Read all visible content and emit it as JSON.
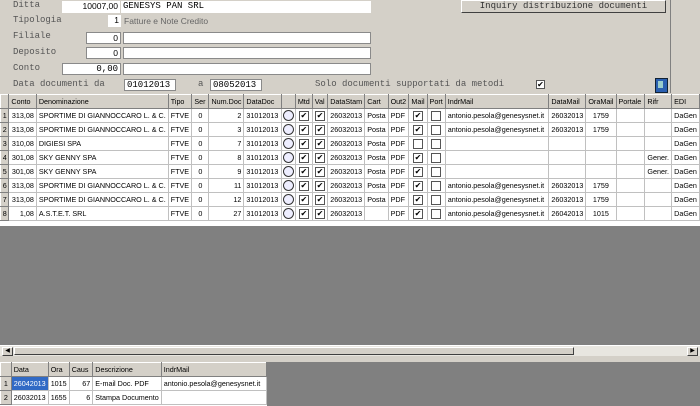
{
  "form": {
    "ditta_label": "Ditta",
    "ditta_code": "10007,00",
    "ditta_name": "GENESYS PAN SRL",
    "tipologia_label": "Tipologia",
    "tipologia_value": "1",
    "tipologia_desc": "Fatture e Note Credito",
    "filiale_label": "Filiale",
    "filiale_value": "0",
    "deposito_label": "Deposito",
    "deposito_value": "0",
    "conto_label": "Conto",
    "conto_value": "0,00",
    "data_label": "Data documenti da",
    "data_from": "01012013",
    "data_to_label": "a",
    "data_to": "08052013",
    "solo_label": "Solo documenti supportati da metodi",
    "solo_checked": "✔",
    "inquiry_button": "Inquiry distribuzione documenti"
  },
  "main_table": {
    "columns": [
      "Conto",
      "Denominazione",
      "Tipo",
      "Ser",
      "Num.Doc",
      "DataDoc",
      "",
      "Mtd",
      "Val",
      "DataStam",
      "Cart",
      "Out2",
      "Mail",
      "Port",
      "IndrMail",
      "DataMail",
      "OraMail",
      "Portale",
      "Rifr",
      "EDI"
    ],
    "rows": [
      {
        "n": "1",
        "conto": "313,08",
        "den": "SPORTIME DI GIANNOCCARO L. & C.",
        "tipo": "FTVE",
        "ser": "0",
        "num": "2",
        "data": "31012013",
        "mtd": "✔",
        "val": "✔",
        "stam": "26032013",
        "cart": "Posta",
        "out2": "PDF",
        "mail": "✔",
        "port": "",
        "indr": "antonio.pesola@genesysnet.it",
        "dmail": "26032013",
        "ora": "1759",
        "portale": "",
        "rifr": "",
        "edi": "DaGen"
      },
      {
        "n": "2",
        "conto": "313,08",
        "den": "SPORTIME DI GIANNOCCARO L. & C.",
        "tipo": "FTVE",
        "ser": "0",
        "num": "3",
        "data": "31012013",
        "mtd": "✔",
        "val": "✔",
        "stam": "26032013",
        "cart": "Posta",
        "out2": "PDF",
        "mail": "✔",
        "port": "",
        "indr": "antonio.pesola@genesysnet.it",
        "dmail": "26032013",
        "ora": "1759",
        "portale": "",
        "rifr": "",
        "edi": "DaGen"
      },
      {
        "n": "3",
        "conto": "310,08",
        "den": "DIGIESI SPA",
        "tipo": "FTVE",
        "ser": "0",
        "num": "7",
        "data": "31012013",
        "mtd": "✔",
        "val": "✔",
        "stam": "26032013",
        "cart": "Posta",
        "out2": "PDF",
        "mail": "",
        "port": "",
        "indr": "",
        "dmail": "",
        "ora": "",
        "portale": "",
        "rifr": "",
        "edi": "DaGen"
      },
      {
        "n": "4",
        "conto": "301,08",
        "den": "SKY GENNY SPA",
        "tipo": "FTVE",
        "ser": "0",
        "num": "8",
        "data": "31012013",
        "mtd": "✔",
        "val": "✔",
        "stam": "26032013",
        "cart": "Posta",
        "out2": "PDF",
        "mail": "✔",
        "port": "",
        "indr": "",
        "dmail": "",
        "ora": "",
        "portale": "",
        "rifr": "Gener.",
        "edi": "DaGen"
      },
      {
        "n": "5",
        "conto": "301,08",
        "den": "SKY GENNY SPA",
        "tipo": "FTVE",
        "ser": "0",
        "num": "9",
        "data": "31012013",
        "mtd": "✔",
        "val": "✔",
        "stam": "26032013",
        "cart": "Posta",
        "out2": "PDF",
        "mail": "✔",
        "port": "",
        "indr": "",
        "dmail": "",
        "ora": "",
        "portale": "",
        "rifr": "Gener.",
        "edi": "DaGen"
      },
      {
        "n": "6",
        "conto": "313,08",
        "den": "SPORTIME DI GIANNOCCARO L. & C.",
        "tipo": "FTVE",
        "ser": "0",
        "num": "11",
        "data": "31012013",
        "mtd": "✔",
        "val": "✔",
        "stam": "26032013",
        "cart": "Posta",
        "out2": "PDF",
        "mail": "✔",
        "port": "",
        "indr": "antonio.pesola@genesysnet.it",
        "dmail": "26032013",
        "ora": "1759",
        "portale": "",
        "rifr": "",
        "edi": "DaGen"
      },
      {
        "n": "7",
        "conto": "313,08",
        "den": "SPORTIME DI GIANNOCCARO L. & C.",
        "tipo": "FTVE",
        "ser": "0",
        "num": "12",
        "data": "31012013",
        "mtd": "✔",
        "val": "✔",
        "stam": "26032013",
        "cart": "Posta",
        "out2": "PDF",
        "mail": "✔",
        "port": "",
        "indr": "antonio.pesola@genesysnet.it",
        "dmail": "26032013",
        "ora": "1759",
        "portale": "",
        "rifr": "",
        "edi": "DaGen"
      },
      {
        "n": "8",
        "conto": "1,08",
        "den": "A.S.T.E.T. SRL",
        "tipo": "FTVE",
        "ser": "0",
        "num": "27",
        "data": "31012013",
        "mtd": "✔",
        "val": "✔",
        "stam": "26032013",
        "cart": "",
        "out2": "PDF",
        "mail": "✔",
        "port": "",
        "indr": "antonio.pesola@genesysnet.it",
        "dmail": "26042013",
        "ora": "1015",
        "portale": "",
        "rifr": "",
        "edi": "DaGen"
      }
    ]
  },
  "detail_table": {
    "columns": [
      "Data",
      "Ora",
      "Caus",
      "Descrizione",
      "IndrMail"
    ],
    "rows": [
      {
        "n": "1",
        "data": "26042013",
        "ora": "1015",
        "caus": "67",
        "desc": "E-mail Doc. PDF",
        "indr": "antonio.pesola@genesysnet.it"
      },
      {
        "n": "2",
        "data": "26032013",
        "ora": "1655",
        "caus": "6",
        "desc": "Stampa Documento",
        "indr": ""
      }
    ]
  },
  "icons": {
    "exit": "exit-door-icon",
    "view": "magnifier-icon"
  }
}
